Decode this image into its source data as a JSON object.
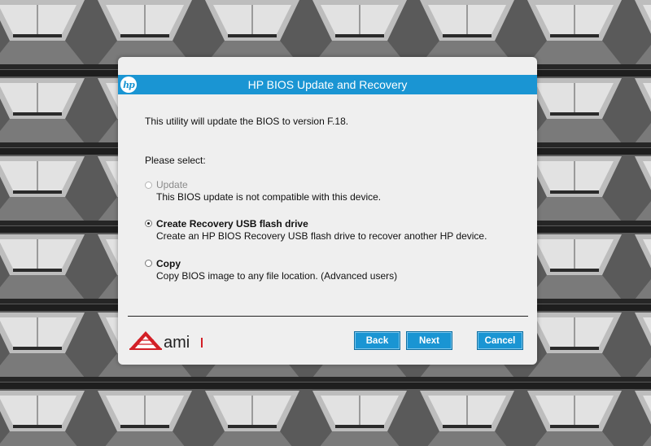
{
  "window": {
    "title": "HP BIOS Update and Recovery",
    "logo_text": "hp"
  },
  "intro": "This utility will update the BIOS to version F.18.",
  "prompt": "Please select:",
  "options": [
    {
      "label": "Update",
      "description": "This BIOS update is not compatible with this device.",
      "selected": false,
      "enabled": false
    },
    {
      "label": "Create Recovery USB flash drive",
      "description": "Create an HP BIOS Recovery USB flash drive to recover another HP device.",
      "selected": true,
      "enabled": true
    },
    {
      "label": "Copy",
      "description": "Copy BIOS image to any file location. (Advanced users)",
      "selected": false,
      "enabled": true
    }
  ],
  "footer": {
    "brand_logo": "ami",
    "buttons": {
      "back": "Back",
      "next": "Next",
      "cancel": "Cancel"
    }
  },
  "colors": {
    "accent": "#1a95d3",
    "dialog_bg": "#efefef",
    "ami_red": "#d31f26"
  }
}
